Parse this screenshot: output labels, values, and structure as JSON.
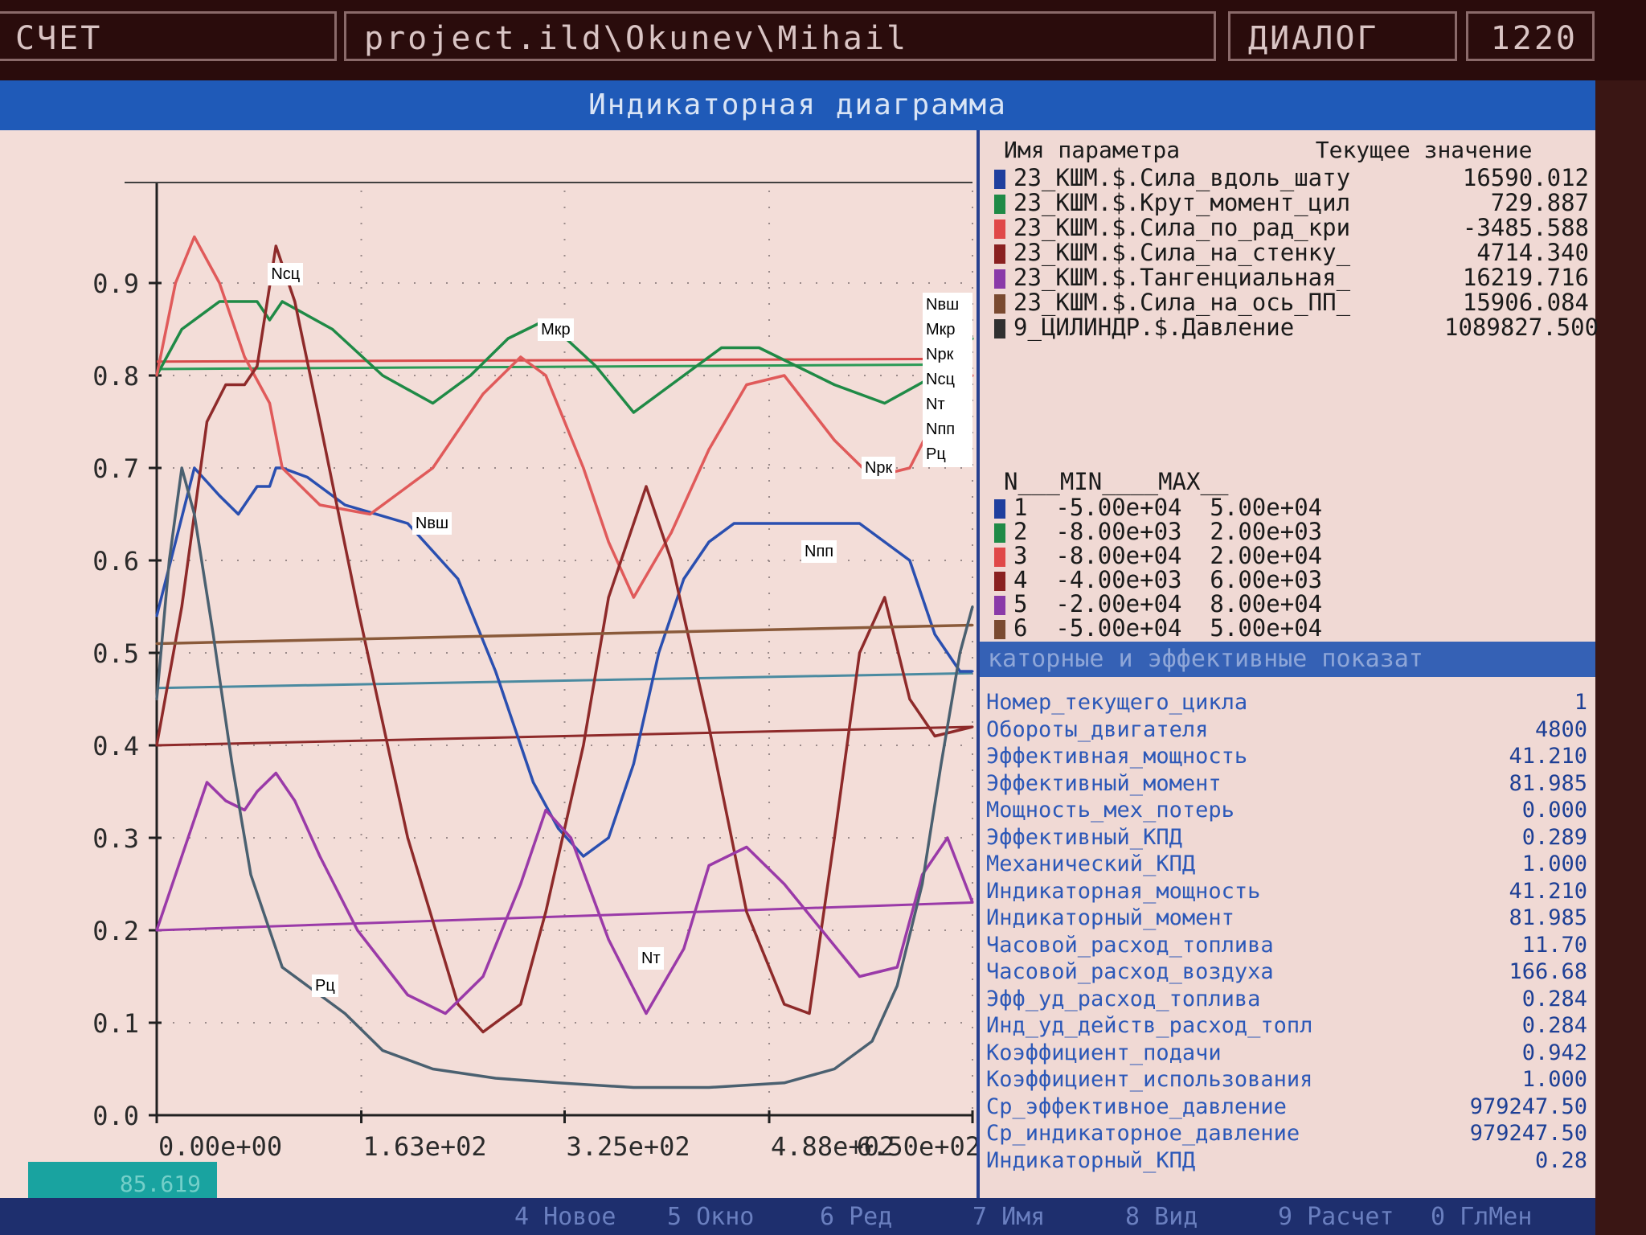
{
  "topbar": {
    "mode": "СЧЕТ",
    "path": "project.ild\\Okunev\\Mihail",
    "dialog": "ДИАЛОГ",
    "number": "1220"
  },
  "window_title": "Индикаторная диаграмма",
  "param_panel": {
    "header_name": "Имя параметра",
    "header_value": "Текущее значение",
    "params": [
      {
        "name": "23_КШМ.$.Сила_вдоль_шату",
        "value": "16590.012",
        "color": "#1f3f9e"
      },
      {
        "name": "23_КШМ.$.Крут_момент_цил",
        "value": "729.887",
        "color": "#1f8a46"
      },
      {
        "name": "23_КШМ.$.Сила_по_рад_кри",
        "value": "-3485.588",
        "color": "#e04848"
      },
      {
        "name": "23_КШМ.$.Сила_на_стенку_",
        "value": "4714.340",
        "color": "#8a2020"
      },
      {
        "name": "23_КШМ.$.Тангенциальная_",
        "value": "16219.716",
        "color": "#8a3aa8"
      },
      {
        "name": "23_КШМ.$.Сила_на_ось_ПП_",
        "value": "15906.084",
        "color": "#7a4a30"
      },
      {
        "name": "9_ЦИЛИНДР.$.Давление",
        "value": "1089827.500",
        "color": "#303030"
      }
    ],
    "range_header": {
      "n": "N",
      "min": "MIN",
      "max": "MAX"
    },
    "ranges": [
      {
        "n": "1",
        "min": "-5.00e+04",
        "max": "5.00e+04",
        "color": "#1f3f9e"
      },
      {
        "n": "2",
        "min": "-8.00e+03",
        "max": "2.00e+03",
        "color": "#1f8a46"
      },
      {
        "n": "3",
        "min": "-8.00e+04",
        "max": "2.00e+04",
        "color": "#e04848"
      },
      {
        "n": "4",
        "min": "-4.00e+03",
        "max": "6.00e+03",
        "color": "#8a2020"
      },
      {
        "n": "5",
        "min": "-2.00e+04",
        "max": "8.00e+04",
        "color": "#8a3aa8"
      },
      {
        "n": "6",
        "min": "-5.00e+04",
        "max": "5.00e+04",
        "color": "#7a4a30"
      }
    ]
  },
  "indicators": {
    "title": "каторные и эффективные показат",
    "rows": [
      {
        "name": "Номер_текущего_цикла",
        "value": "1"
      },
      {
        "name": "Обороты_двигателя",
        "value": "4800"
      },
      {
        "name": "Эффективная_мощность",
        "value": "41.210"
      },
      {
        "name": "Эффективный_момент",
        "value": "81.985"
      },
      {
        "name": "Мощность_мех_потерь",
        "value": "0.000"
      },
      {
        "name": "Эффективный_КПД",
        "value": "0.289"
      },
      {
        "name": "Механический_КПД",
        "value": "1.000"
      },
      {
        "name": "Индикаторная_мощность",
        "value": "41.210"
      },
      {
        "name": "Индикаторный_момент",
        "value": "81.985"
      },
      {
        "name": "Часовой_расход_топлива",
        "value": "11.70"
      },
      {
        "name": "Часовой_расход_воздуха",
        "value": "166.68"
      },
      {
        "name": "Эфф_уд_расход_топлива",
        "value": "0.284"
      },
      {
        "name": "Инд_уд_действ_расход_топл",
        "value": "0.284"
      },
      {
        "name": "Коэффициент_подачи",
        "value": "0.942"
      },
      {
        "name": "Коэффициент_использования",
        "value": "1.000"
      },
      {
        "name": "Ср_эффективное_давление",
        "value": "979247.50"
      },
      {
        "name": "Ср_индикаторное_давление",
        "value": "979247.50"
      },
      {
        "name": "Индикаторный_КПД",
        "value": "0.28"
      }
    ]
  },
  "status_value": "85.619",
  "function_keys": [
    "4 Новое",
    "5 Окно",
    "6 Ред",
    "7 Имя",
    "8 Вид",
    "9 Расчет",
    "0 ГлМен"
  ],
  "chart_data": {
    "type": "line",
    "xlim": [
      0,
      650
    ],
    "ylim": [
      0,
      1.0
    ],
    "xticks": [
      "0.00e+00",
      "1.63e+02",
      "3.25e+02",
      "4.88e+02",
      "6.50e+02"
    ],
    "xtick_values": [
      0,
      163,
      325,
      488,
      650
    ],
    "yticks": [
      "0.0",
      "0.1",
      "0.2",
      "0.3",
      "0.4",
      "0.5",
      "0.6",
      "0.7",
      "0.8",
      "0.9"
    ],
    "ytick_values": [
      0,
      0.1,
      0.2,
      0.3,
      0.4,
      0.5,
      0.6,
      0.7,
      0.8,
      0.9
    ],
    "grid": true,
    "legend_position": "top-right",
    "legend": [
      "Nвш",
      "Мкр",
      "Nрк",
      "Nсц",
      "Nт",
      "Nпп",
      "Рц"
    ],
    "annotations": [
      {
        "text": "Nсц",
        "x": 95,
        "y": 0.91
      },
      {
        "text": "Мкр",
        "x": 310,
        "y": 0.85
      },
      {
        "text": "Nвш",
        "x": 210,
        "y": 0.64
      },
      {
        "text": "Nрк",
        "x": 568,
        "y": 0.7
      },
      {
        "text": "Nпп",
        "x": 520,
        "y": 0.61
      },
      {
        "text": "Nт",
        "x": 390,
        "y": 0.17
      },
      {
        "text": "Рц",
        "x": 130,
        "y": 0.14
      }
    ],
    "series": [
      {
        "name": "Nвш",
        "color": "#2a4fb0",
        "x": [
          0,
          15,
          30,
          50,
          65,
          80,
          90,
          95,
          100,
          120,
          150,
          200,
          240,
          270,
          300,
          320,
          340,
          360,
          380,
          400,
          420,
          440,
          460,
          480,
          500,
          520,
          560,
          600,
          620,
          640,
          650
        ],
        "y": [
          0.54,
          0.62,
          0.7,
          0.67,
          0.65,
          0.68,
          0.68,
          0.7,
          0.7,
          0.69,
          0.66,
          0.64,
          0.58,
          0.48,
          0.36,
          0.31,
          0.28,
          0.3,
          0.38,
          0.5,
          0.58,
          0.62,
          0.64,
          0.64,
          0.64,
          0.64,
          0.64,
          0.6,
          0.52,
          0.48,
          0.48
        ]
      },
      {
        "name": "Мкр",
        "color": "#1f8a46",
        "x": [
          0,
          20,
          50,
          80,
          90,
          100,
          140,
          180,
          220,
          250,
          280,
          310,
          350,
          380,
          420,
          450,
          480,
          510,
          540,
          580,
          620,
          650
        ],
        "y": [
          0.8,
          0.85,
          0.88,
          0.88,
          0.86,
          0.88,
          0.85,
          0.8,
          0.77,
          0.8,
          0.84,
          0.86,
          0.81,
          0.76,
          0.8,
          0.83,
          0.83,
          0.81,
          0.79,
          0.77,
          0.8,
          0.84
        ]
      },
      {
        "name": "Nрк",
        "color": "#e05a5a",
        "x": [
          0,
          15,
          30,
          50,
          70,
          90,
          100,
          130,
          170,
          220,
          260,
          290,
          310,
          340,
          360,
          380,
          410,
          440,
          470,
          500,
          540,
          570,
          600,
          630,
          650
        ],
        "y": [
          0.8,
          0.9,
          0.95,
          0.9,
          0.82,
          0.77,
          0.7,
          0.66,
          0.65,
          0.7,
          0.78,
          0.82,
          0.8,
          0.7,
          0.62,
          0.56,
          0.63,
          0.72,
          0.79,
          0.8,
          0.73,
          0.69,
          0.7,
          0.78,
          0.8
        ]
      },
      {
        "name": "Nсц",
        "color": "#8e2a2a",
        "x": [
          0,
          20,
          40,
          55,
          70,
          80,
          95,
          110,
          130,
          160,
          200,
          240,
          260,
          290,
          310,
          340,
          360,
          390,
          410,
          440,
          470,
          500,
          520,
          540,
          560,
          580,
          600,
          620,
          650
        ],
        "y": [
          0.4,
          0.55,
          0.75,
          0.79,
          0.79,
          0.81,
          0.94,
          0.88,
          0.75,
          0.55,
          0.3,
          0.12,
          0.09,
          0.12,
          0.22,
          0.4,
          0.56,
          0.68,
          0.6,
          0.42,
          0.22,
          0.12,
          0.11,
          0.3,
          0.5,
          0.56,
          0.45,
          0.41,
          0.42
        ]
      },
      {
        "name": "Nт",
        "color": "#9a3aa8",
        "x": [
          0,
          20,
          40,
          55,
          70,
          80,
          95,
          110,
          130,
          160,
          200,
          230,
          260,
          290,
          310,
          330,
          360,
          390,
          420,
          440,
          470,
          500,
          530,
          560,
          590,
          610,
          630,
          650
        ],
        "y": [
          0.2,
          0.28,
          0.36,
          0.34,
          0.33,
          0.35,
          0.37,
          0.34,
          0.28,
          0.2,
          0.13,
          0.11,
          0.15,
          0.25,
          0.33,
          0.3,
          0.19,
          0.11,
          0.18,
          0.27,
          0.29,
          0.25,
          0.2,
          0.15,
          0.16,
          0.26,
          0.3,
          0.23
        ]
      },
      {
        "name": "Nпп",
        "color": "#8a5a3a",
        "x": [
          0,
          650
        ],
        "y": [
          0.51,
          0.53
        ]
      },
      {
        "name": "Рц",
        "color": "#4a6070",
        "x": [
          0,
          10,
          20,
          30,
          45,
          60,
          75,
          90,
          100,
          120,
          150,
          180,
          220,
          270,
          320,
          380,
          440,
          500,
          540,
          570,
          590,
          610,
          625,
          640,
          650
        ],
        "y": [
          0.45,
          0.6,
          0.7,
          0.65,
          0.52,
          0.38,
          0.26,
          0.2,
          0.16,
          0.14,
          0.11,
          0.07,
          0.05,
          0.04,
          0.035,
          0.03,
          0.03,
          0.035,
          0.05,
          0.08,
          0.14,
          0.25,
          0.38,
          0.5,
          0.55
        ]
      }
    ],
    "reference_lines": [
      {
        "color": "#d84a4a",
        "y": [
          0.815,
          0.818
        ]
      },
      {
        "color": "#2a9a56",
        "y": [
          0.807,
          0.812
        ]
      },
      {
        "color": "#4a8aa0",
        "y": [
          0.462,
          0.478
        ]
      },
      {
        "color": "#8e2a2a",
        "y": [
          0.4,
          0.42
        ]
      },
      {
        "color": "#9a3aa8",
        "y": [
          0.2,
          0.23
        ]
      }
    ]
  }
}
